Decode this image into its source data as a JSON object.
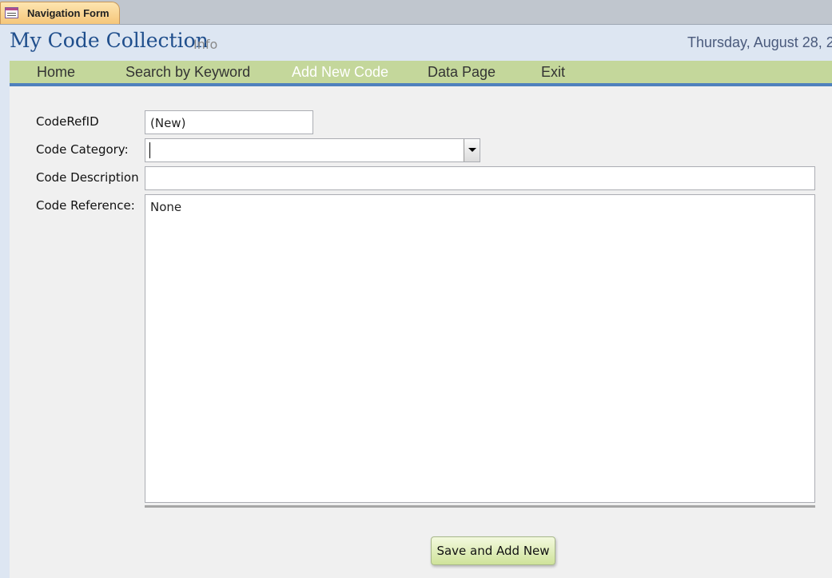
{
  "tab": {
    "label": "Navigation Form"
  },
  "header": {
    "title": "My Code Collection",
    "info": "Info",
    "date": "Thursday, August 28, 2"
  },
  "nav": {
    "items": [
      {
        "label": "Home"
      },
      {
        "label": "Search by Keyword"
      },
      {
        "label": "Add New Code"
      },
      {
        "label": "Data Page"
      },
      {
        "label": "Exit"
      }
    ],
    "active": "Add New Code"
  },
  "form": {
    "coderefid_label": "CodeRefID",
    "coderefid_value": "(New)",
    "category_label": "Code Category:",
    "category_value": "",
    "description_label": "Code Description",
    "description_value": "",
    "reference_label": "Code Reference:",
    "reference_value": "None",
    "save_label": "Save and Add New"
  },
  "colors": {
    "nav_bg": "#c4d79b",
    "nav_border": "#4f81bd",
    "title": "#1f4e8c",
    "active_nav": "#ffffff",
    "button_bg": "#cfe39a"
  }
}
